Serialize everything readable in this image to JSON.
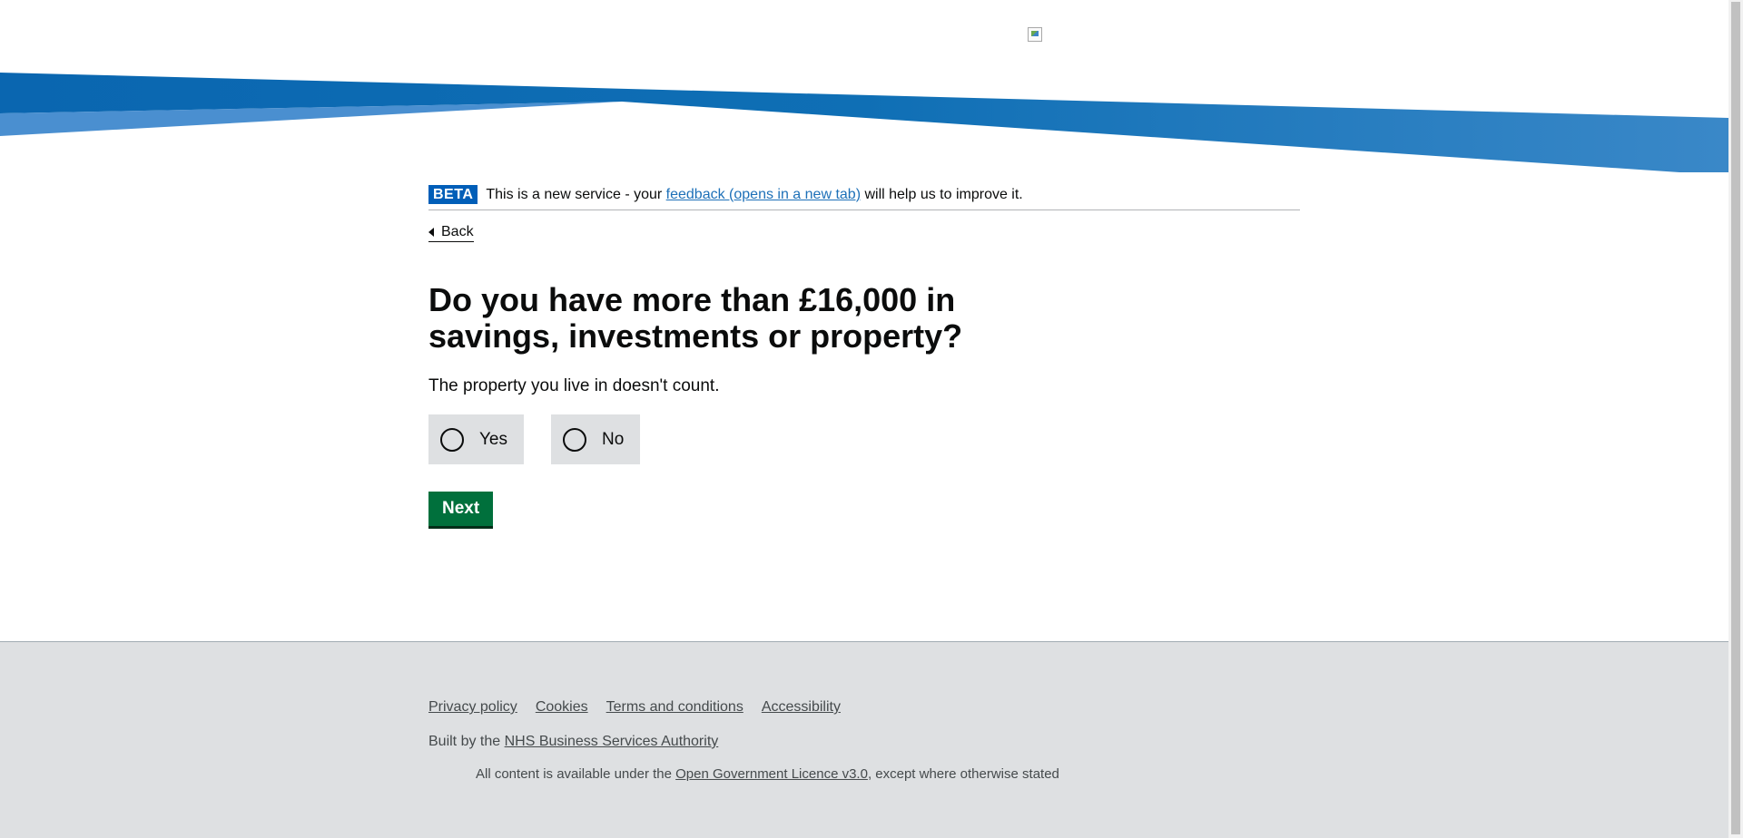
{
  "phase_banner": {
    "tag": "BETA",
    "text_before": "This is a new service - your ",
    "link_text": "feedback (opens in a new tab)",
    "text_after": " will help us to improve it."
  },
  "back_link": {
    "label": "Back"
  },
  "question": {
    "title": "Do you have more than £16,000 in savings, investments or property?",
    "hint": "The property you live in doesn't count.",
    "options": [
      {
        "label": "Yes",
        "selected": false
      },
      {
        "label": "No",
        "selected": false
      }
    ]
  },
  "actions": {
    "next_label": "Next"
  },
  "footer": {
    "links": [
      "Privacy policy",
      "Cookies",
      "Terms and conditions",
      "Accessibility"
    ],
    "built_by_prefix": "Built by the ",
    "built_by_link": "NHS Business Services Authority",
    "licence_prefix": "All content is available under the ",
    "licence_link": "Open Government Licence v3.0",
    "licence_suffix": ", except where otherwise stated"
  },
  "colors": {
    "banner_dark": "#0066b3",
    "banner_light": "#4a90d0",
    "primary_button": "#00703c",
    "phase_tag": "#005eb8",
    "footer_bg": "#dee0e2",
    "radio_bg": "#dee0e2"
  }
}
